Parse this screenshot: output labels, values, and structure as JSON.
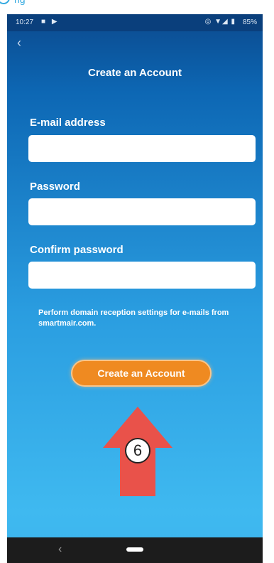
{
  "top_marker": {
    "fragment": "ng"
  },
  "status_bar": {
    "time": "10:27",
    "notification_icons": "■ ▶",
    "system_icons": "◎ ▼◢ ▮",
    "battery": "85%"
  },
  "header": {
    "title": "Create an Account"
  },
  "form": {
    "email": {
      "label": "E-mail address",
      "value": "",
      "placeholder": ""
    },
    "password": {
      "label": "Password",
      "value": "",
      "placeholder": ""
    },
    "confirm": {
      "label": "Confirm password",
      "value": "",
      "placeholder": ""
    }
  },
  "note": "Perform domain reception settings for e-mails from smartmair.com.",
  "create_button": {
    "label": "Create an Account",
    "color": "#ef8a21"
  },
  "callout": {
    "number": "6",
    "color": "#e9524a"
  },
  "nav_bar": {
    "back": "‹"
  },
  "colors": {
    "background_top": "#0b4a8e",
    "background_bottom": "#3fb9f0"
  }
}
